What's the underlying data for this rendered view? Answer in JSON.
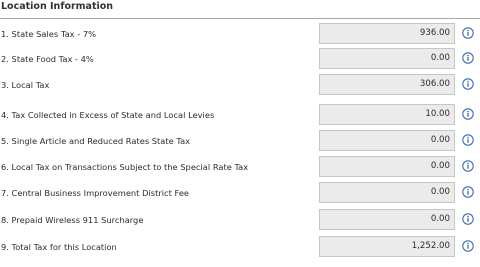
{
  "section": {
    "title": "Location Information"
  },
  "colors": {
    "info_icon": "#3a6db5",
    "field_bg": "#ebebeb",
    "field_border": "#c6c6c6"
  },
  "rows": [
    {
      "label": "1.  State Sales Tax - 7%",
      "value": "936.00",
      "icon": "info-icon"
    },
    {
      "label": "2.  State Food Tax - 4%",
      "value": "0.00",
      "icon": "info-icon"
    },
    {
      "label": "3.  Local Tax",
      "value": "306.00",
      "icon": "info-icon"
    },
    {
      "label": "4.  Tax Collected in Excess of State and Local Levies",
      "value": "10.00",
      "icon": "info-icon"
    },
    {
      "label": "5.  Single Article and Reduced Rates State Tax",
      "value": "0.00",
      "icon": "info-icon"
    },
    {
      "label": "6.  Local Tax on Transactions Subject to the Special Rate Tax",
      "value": "0.00",
      "icon": "info-icon"
    },
    {
      "label": "7.  Central Business Improvement District Fee",
      "value": "0.00",
      "icon": "info-icon"
    },
    {
      "label": "8.  Prepaid Wireless 911 Surcharge",
      "value": "0.00",
      "icon": "info-icon"
    },
    {
      "label": "9.  Total Tax for this Location",
      "value": "1,252.00",
      "icon": "info-icon"
    }
  ]
}
